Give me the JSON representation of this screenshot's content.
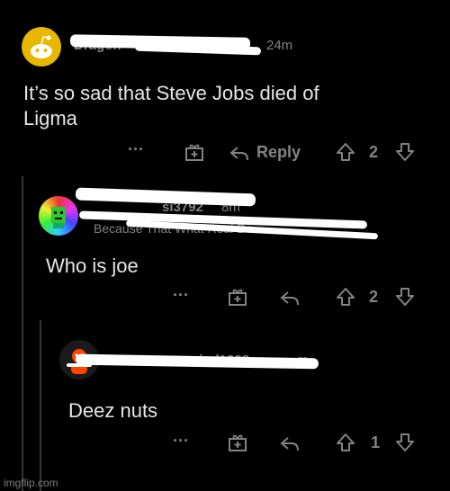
{
  "comments": [
    {
      "author": "Dragon",
      "time": "24m",
      "body": "It’s so sad that Steve Jobs died of\nLigma",
      "votes": "2",
      "reply_label": "Reply"
    },
    {
      "author": "si3792",
      "time": "8m",
      "subtitle": "Because That What Real Do",
      "body": "Who is joe",
      "votes": "2"
    },
    {
      "author": "gind1238",
      "time": "m",
      "body": "Deez nuts",
      "votes": "1"
    }
  ],
  "watermark": "imgflip.com",
  "colors": {
    "background": "#000000",
    "muted": "#818384",
    "text": "#d7dadc",
    "reddit_orange": "#ff4500"
  }
}
